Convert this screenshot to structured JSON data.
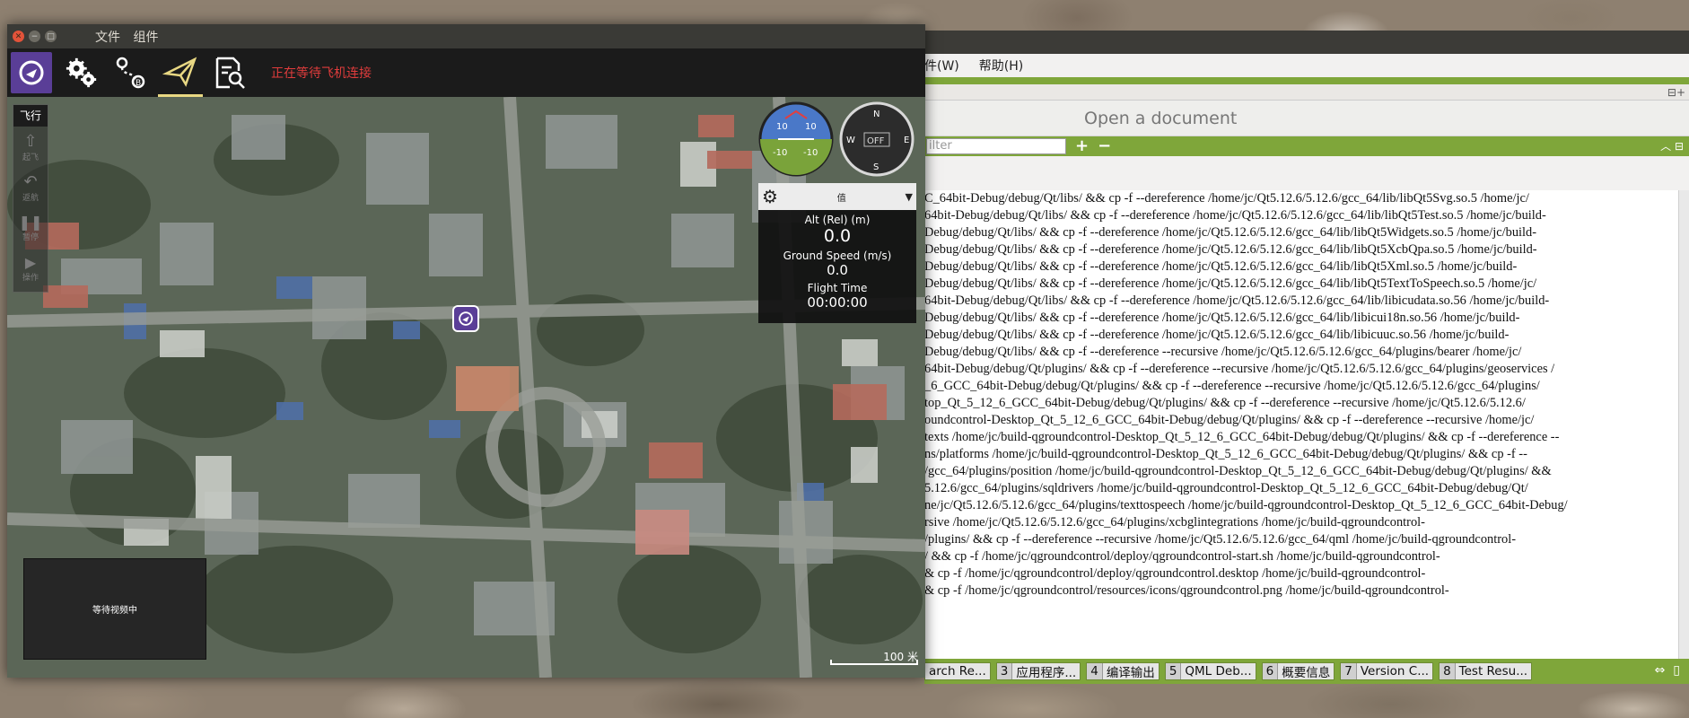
{
  "qgc": {
    "menu": [
      "文件",
      "组件"
    ],
    "status_text": "正在等待飞机连接",
    "colors": {
      "brand": "#5a3e97",
      "status": "#e03c3c",
      "active_underline": "#e9d883"
    },
    "toolbar_icons": [
      "qgc-logo-icon",
      "settings-gear-icon",
      "plan-route-icon",
      "fly-paper-plane-icon",
      "analyze-doc-icon"
    ],
    "toolstrip": {
      "title": "飞行",
      "buttons": [
        {
          "label": "起飞",
          "icon": "takeoff-icon"
        },
        {
          "label": "返航",
          "icon": "return-icon"
        },
        {
          "label": "暂停",
          "icon": "pause-icon"
        },
        {
          "label": "操作",
          "icon": "action-icon"
        }
      ]
    },
    "compass": {
      "n": "N",
      "s": "S",
      "e": "E",
      "w": "W",
      "state": "OFF"
    },
    "attitude": {
      "top": "10",
      "bottom": "-10"
    },
    "telemetry": {
      "header_icon": "gear-icon",
      "header_mid": "值",
      "items": [
        {
          "label": "Alt (Rel) (m)",
          "value": "0.0"
        },
        {
          "label": "Ground Speed (m/s)",
          "value": "0.0"
        },
        {
          "label": "Flight Time",
          "value": "00:00:00"
        }
      ]
    },
    "video_text": "等待视频中",
    "scale_label": "100 米"
  },
  "creator": {
    "menu": [
      "件(W)",
      "帮助(H)"
    ],
    "open_document": "Open a document",
    "filter_placeholder": "ilter",
    "log_lines": [
      "C_64bit-Debug/debug/Qt/libs/ && cp -f --dereference /home/jc/Qt5.12.6/5.12.6/gcc_64/lib/libQt5Svg.so.5 /home/jc/",
      "64bit-Debug/debug/Qt/libs/ && cp -f --dereference /home/jc/Qt5.12.6/5.12.6/gcc_64/lib/libQt5Test.so.5 /home/jc/build-",
      "Debug/debug/Qt/libs/ && cp -f --dereference /home/jc/Qt5.12.6/5.12.6/gcc_64/lib/libQt5Widgets.so.5 /home/jc/build-",
      "Debug/debug/Qt/libs/ && cp -f --dereference /home/jc/Qt5.12.6/5.12.6/gcc_64/lib/libQt5XcbQpa.so.5 /home/jc/build-",
      "Debug/debug/Qt/libs/ && cp -f --dereference /home/jc/Qt5.12.6/5.12.6/gcc_64/lib/libQt5Xml.so.5 /home/jc/build-",
      "Debug/debug/Qt/libs/ && cp -f --dereference /home/jc/Qt5.12.6/5.12.6/gcc_64/lib/libQt5TextToSpeech.so.5 /home/jc/",
      "64bit-Debug/debug/Qt/libs/ && cp -f --dereference /home/jc/Qt5.12.6/5.12.6/gcc_64/lib/libicudata.so.56 /home/jc/build-",
      "Debug/debug/Qt/libs/ && cp -f --dereference /home/jc/Qt5.12.6/5.12.6/gcc_64/lib/libicui18n.so.56 /home/jc/build-",
      "Debug/debug/Qt/libs/ && cp -f --dereference /home/jc/Qt5.12.6/5.12.6/gcc_64/lib/libicuuc.so.56 /home/jc/build-",
      "Debug/debug/Qt/libs/ && cp -f --dereference --recursive /home/jc/Qt5.12.6/5.12.6/gcc_64/plugins/bearer /home/jc/",
      "64bit-Debug/debug/Qt/plugins/ && cp -f --dereference --recursive /home/jc/Qt5.12.6/5.12.6/gcc_64/plugins/geoservices /",
      "_6_GCC_64bit-Debug/debug/Qt/plugins/ && cp -f --dereference --recursive /home/jc/Qt5.12.6/5.12.6/gcc_64/plugins/",
      "top_Qt_5_12_6_GCC_64bit-Debug/debug/Qt/plugins/ && cp -f --dereference --recursive /home/jc/Qt5.12.6/5.12.6/",
      "oundcontrol-Desktop_Qt_5_12_6_GCC_64bit-Debug/debug/Qt/plugins/ && cp -f --dereference --recursive /home/jc/",
      "texts /home/jc/build-qgroundcontrol-Desktop_Qt_5_12_6_GCC_64bit-Debug/debug/Qt/plugins/ && cp -f --dereference --",
      "ns/platforms /home/jc/build-qgroundcontrol-Desktop_Qt_5_12_6_GCC_64bit-Debug/debug/Qt/plugins/ && cp -f --",
      "/gcc_64/plugins/position /home/jc/build-qgroundcontrol-Desktop_Qt_5_12_6_GCC_64bit-Debug/debug/Qt/plugins/ &&",
      "5.12.6/gcc_64/plugins/sqldrivers /home/jc/build-qgroundcontrol-Desktop_Qt_5_12_6_GCC_64bit-Debug/debug/Qt/",
      "ne/jc/Qt5.12.6/5.12.6/gcc_64/plugins/texttospeech /home/jc/build-qgroundcontrol-Desktop_Qt_5_12_6_GCC_64bit-Debug/",
      "rsive /home/jc/Qt5.12.6/5.12.6/gcc_64/plugins/xcbglintegrations /home/jc/build-qgroundcontrol-",
      "/plugins/ && cp -f --dereference --recursive /home/jc/Qt5.12.6/5.12.6/gcc_64/qml /home/jc/build-qgroundcontrol-",
      "/ && cp -f /home/jc/qgroundcontrol/deploy/qgroundcontrol-start.sh /home/jc/build-qgroundcontrol-",
      "& cp -f /home/jc/qgroundcontrol/deploy/qgroundcontrol.desktop /home/jc/build-qgroundcontrol-",
      "& cp -f /home/jc/qgroundcontrol/resources/icons/qgroundcontrol.png /home/jc/build-qgroundcontrol-"
    ],
    "output_tabs": [
      {
        "num": "",
        "label": "arch Re..."
      },
      {
        "num": "3",
        "label": "应用程序..."
      },
      {
        "num": "4",
        "label": "编译输出"
      },
      {
        "num": "5",
        "label": "QML Deb..."
      },
      {
        "num": "6",
        "label": "概要信息"
      },
      {
        "num": "7",
        "label": "Version C..."
      },
      {
        "num": "8",
        "label": "Test Resu..."
      }
    ],
    "colors": {
      "accent": "#7fa63a"
    }
  }
}
